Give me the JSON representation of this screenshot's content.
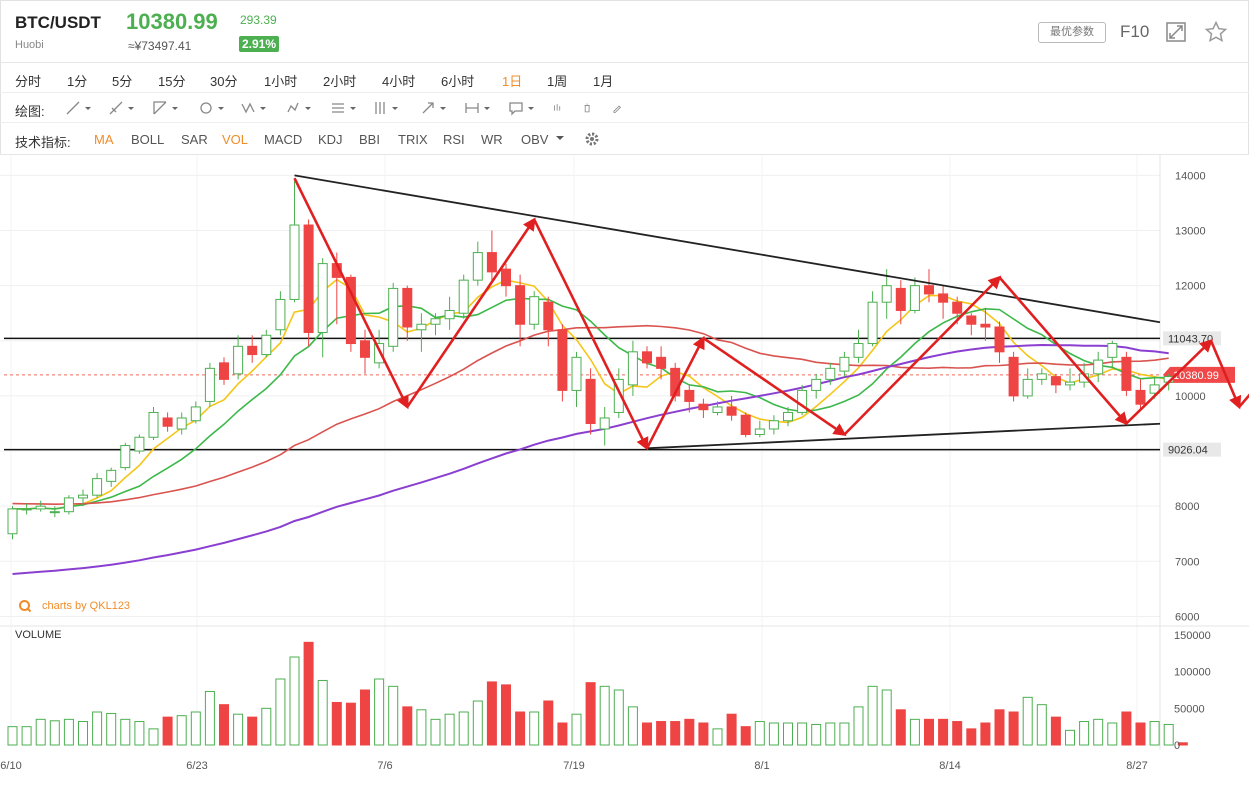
{
  "header": {
    "pair": "BTC/USDT",
    "exchange": "Huobi",
    "price": "10380.99",
    "cny_price": "≈¥73497.41",
    "change": "293.39",
    "change_pct": "2.91%",
    "params_btn": "最优参数",
    "f10": "F10",
    "icons": [
      "fullscreen-icon",
      "star-icon"
    ]
  },
  "periods": {
    "items": [
      "分时",
      "1分",
      "5分",
      "15分",
      "30分",
      "1小时",
      "2小时",
      "4小时",
      "6小时",
      "1日",
      "1周",
      "1月"
    ],
    "active": "1日"
  },
  "drawing": {
    "label": "绘图:",
    "tools": [
      "line-tool-icon",
      "ray-tool-icon",
      "channel-tool-icon",
      "circle-tool-icon",
      "zigzag-tool-icon",
      "pattern-tool-icon",
      "fib-tool-icon",
      "gann-tool-icon",
      "arrow-tool-icon",
      "measure-tool-icon",
      "note-tool-icon",
      "candle-tool-icon",
      "trash-icon",
      "brush-icon"
    ]
  },
  "indicators": {
    "label": "技术指标:",
    "items": [
      "MA",
      "BOLL",
      "SAR",
      "VOL",
      "MACD",
      "KDJ",
      "BBI",
      "TRIX",
      "RSI",
      "WR",
      "OBV"
    ],
    "active": [
      "MA",
      "VOL"
    ]
  },
  "branding": "charts by QKL123",
  "volume_label": "VOLUME",
  "colors": {
    "up": "#4caf50",
    "down": "#ef4444",
    "accent": "#f08c2a",
    "ma5": "#f5c518",
    "ma10": "#3db84a",
    "ma30": "#d9534f",
    "ma60": "#8a3fd1",
    "annotation": "#e02020"
  },
  "chart_data": {
    "type": "candlestick",
    "x_tick_labels": [
      "6/10",
      "6/23",
      "7/6",
      "7/19",
      "8/1",
      "8/14",
      "8/27"
    ],
    "price_axis": {
      "ticks": [
        14000,
        13000,
        12000,
        10000,
        8000,
        7000,
        6000
      ],
      "ylim": [
        6000,
        14000
      ]
    },
    "volume_axis": {
      "ticks": [
        150000,
        100000,
        50000,
        0
      ],
      "ylim": [
        0,
        150000
      ]
    },
    "levels": [
      {
        "value": 11043.7,
        "label": "11043.70"
      },
      {
        "value": 9026.04,
        "label": "9026.04"
      }
    ],
    "current_price": {
      "value": 10380.99,
      "label": "10380.99"
    },
    "candles": [
      [
        7500,
        7950,
        7400,
        8000
      ],
      [
        7950,
        7950,
        7850,
        8050
      ],
      [
        7950,
        8000,
        7900,
        8100
      ],
      [
        7900,
        7900,
        7800,
        8000
      ],
      [
        7900,
        8150,
        7850,
        8200
      ],
      [
        8150,
        8200,
        8000,
        8300
      ],
      [
        8200,
        8500,
        8150,
        8600
      ],
      [
        8450,
        8650,
        8350,
        8700
      ],
      [
        8700,
        9100,
        8650,
        9150
      ],
      [
        9000,
        9250,
        8950,
        9300
      ],
      [
        9250,
        9700,
        9200,
        9800
      ],
      [
        9600,
        9450,
        9350,
        9700
      ],
      [
        9400,
        9600,
        9300,
        9700
      ],
      [
        9550,
        9800,
        9500,
        9900
      ],
      [
        9900,
        10500,
        9800,
        10600
      ],
      [
        10600,
        10300,
        10200,
        10700
      ],
      [
        10400,
        10900,
        10300,
        11100
      ],
      [
        10900,
        10750,
        10600,
        11100
      ],
      [
        10750,
        11100,
        10700,
        11200
      ],
      [
        11200,
        11750,
        11100,
        11900
      ],
      [
        11750,
        13100,
        11700,
        13900
      ],
      [
        13100,
        11150,
        10900,
        13200
      ],
      [
        11150,
        12400,
        10700,
        12500
      ],
      [
        12400,
        12150,
        11300,
        12600
      ],
      [
        12150,
        10950,
        10800,
        12200
      ],
      [
        11000,
        10700,
        10400,
        11200
      ],
      [
        10600,
        10950,
        10500,
        11200
      ],
      [
        10900,
        11950,
        10800,
        12050
      ],
      [
        11950,
        11250,
        11000,
        12000
      ],
      [
        11200,
        11300,
        10800,
        11500
      ],
      [
        11300,
        11400,
        11100,
        11500
      ],
      [
        11400,
        11550,
        11200,
        11800
      ],
      [
        11500,
        12100,
        11400,
        12200
      ],
      [
        12100,
        12600,
        12000,
        12800
      ],
      [
        12600,
        12250,
        12100,
        13000
      ],
      [
        12300,
        12000,
        11800,
        12400
      ],
      [
        12000,
        11300,
        10900,
        12200
      ],
      [
        11300,
        11800,
        11200,
        11900
      ],
      [
        11700,
        11200,
        10900,
        11800
      ],
      [
        11200,
        10100,
        9900,
        11300
      ],
      [
        10100,
        10700,
        9800,
        10800
      ],
      [
        10300,
        9500,
        9300,
        10500
      ],
      [
        9400,
        9600,
        9100,
        9800
      ],
      [
        9700,
        10300,
        9600,
        10500
      ],
      [
        10200,
        10800,
        10000,
        11000
      ],
      [
        10800,
        10600,
        10500,
        10900
      ],
      [
        10700,
        10500,
        10300,
        10900
      ],
      [
        10500,
        10000,
        9900,
        10600
      ],
      [
        10100,
        9900,
        9700,
        10200
      ],
      [
        9850,
        9750,
        9600,
        9950
      ],
      [
        9700,
        9800,
        9650,
        9900
      ],
      [
        9800,
        9650,
        9550,
        10000
      ],
      [
        9650,
        9300,
        9250,
        9700
      ],
      [
        9300,
        9400,
        9250,
        9550
      ],
      [
        9400,
        9550,
        9300,
        9650
      ],
      [
        9550,
        9700,
        9450,
        9800
      ],
      [
        9700,
        10100,
        9650,
        10200
      ],
      [
        10100,
        10300,
        9950,
        10400
      ],
      [
        10300,
        10500,
        10200,
        10600
      ],
      [
        10450,
        10700,
        10350,
        10800
      ],
      [
        10700,
        10950,
        10600,
        11200
      ],
      [
        10950,
        11700,
        10900,
        11900
      ],
      [
        11700,
        12000,
        11400,
        12300
      ],
      [
        11950,
        11550,
        11300,
        12100
      ],
      [
        11550,
        12000,
        11500,
        12150
      ],
      [
        12000,
        11850,
        11700,
        12300
      ],
      [
        11850,
        11700,
        11400,
        12000
      ],
      [
        11700,
        11500,
        11300,
        11800
      ],
      [
        11450,
        11300,
        11100,
        11500
      ],
      [
        11300,
        11250,
        11000,
        11600
      ],
      [
        11250,
        10800,
        10600,
        11350
      ],
      [
        10700,
        10000,
        9900,
        10800
      ],
      [
        10000,
        10300,
        9950,
        10500
      ],
      [
        10300,
        10400,
        10200,
        10500
      ],
      [
        10350,
        10200,
        10050,
        10400
      ],
      [
        10200,
        10250,
        10100,
        10500
      ],
      [
        10250,
        10400,
        10150,
        10600
      ],
      [
        10400,
        10650,
        10250,
        10800
      ],
      [
        10700,
        10950,
        10500,
        11000
      ],
      [
        10700,
        10100,
        10000,
        10800
      ],
      [
        10100,
        9850,
        9750,
        10300
      ],
      [
        10050,
        10200,
        9950,
        10350
      ],
      [
        10250,
        10350,
        10100,
        10400
      ]
    ],
    "volume": [
      25000,
      25000,
      35000,
      33000,
      35000,
      32000,
      45000,
      43000,
      35000,
      32000,
      22000,
      38000,
      40000,
      45000,
      73000,
      55000,
      42000,
      38000,
      50000,
      90000,
      120000,
      140000,
      88000,
      58000,
      57000,
      75000,
      90000,
      80000,
      52000,
      48000,
      35000,
      42000,
      45000,
      60000,
      86000,
      82000,
      45000,
      45000,
      60000,
      30000,
      42000,
      85000,
      80000,
      75000,
      52000,
      30000,
      32000,
      32000,
      35000,
      30000,
      22000,
      42000,
      25000,
      32000,
      30000,
      30000,
      30000,
      28000,
      30000,
      30000,
      52000,
      80000,
      75000,
      48000,
      35000,
      35000,
      35000,
      32000,
      22000,
      30000,
      48000,
      45000,
      65000,
      55000,
      38000,
      20000,
      32000,
      35000,
      30000,
      45000,
      30000,
      32000,
      28000,
      3000
    ],
    "ma_series": [
      {
        "name": "MA5",
        "key": "ma5"
      },
      {
        "name": "MA10",
        "key": "ma10"
      },
      {
        "name": "MA30",
        "key": "ma30"
      },
      {
        "name": "MA60",
        "key": "ma60"
      }
    ],
    "trendlines": {
      "upper": [
        [
          20,
          14000
        ],
        [
          98,
          11300
        ]
      ],
      "lower": [
        [
          45,
          9050
        ],
        [
          98,
          9550
        ]
      ]
    },
    "zigzag": [
      [
        20,
        13950
      ],
      [
        28,
        9800
      ],
      [
        37,
        13200
      ],
      [
        45,
        9050
      ],
      [
        49,
        11050
      ],
      [
        59,
        9300
      ],
      [
        70,
        12150
      ],
      [
        79,
        9500
      ],
      [
        85,
        11000
      ],
      [
        87,
        9800
      ],
      [
        89,
        10400
      ],
      [
        95,
        7900
      ]
    ]
  }
}
